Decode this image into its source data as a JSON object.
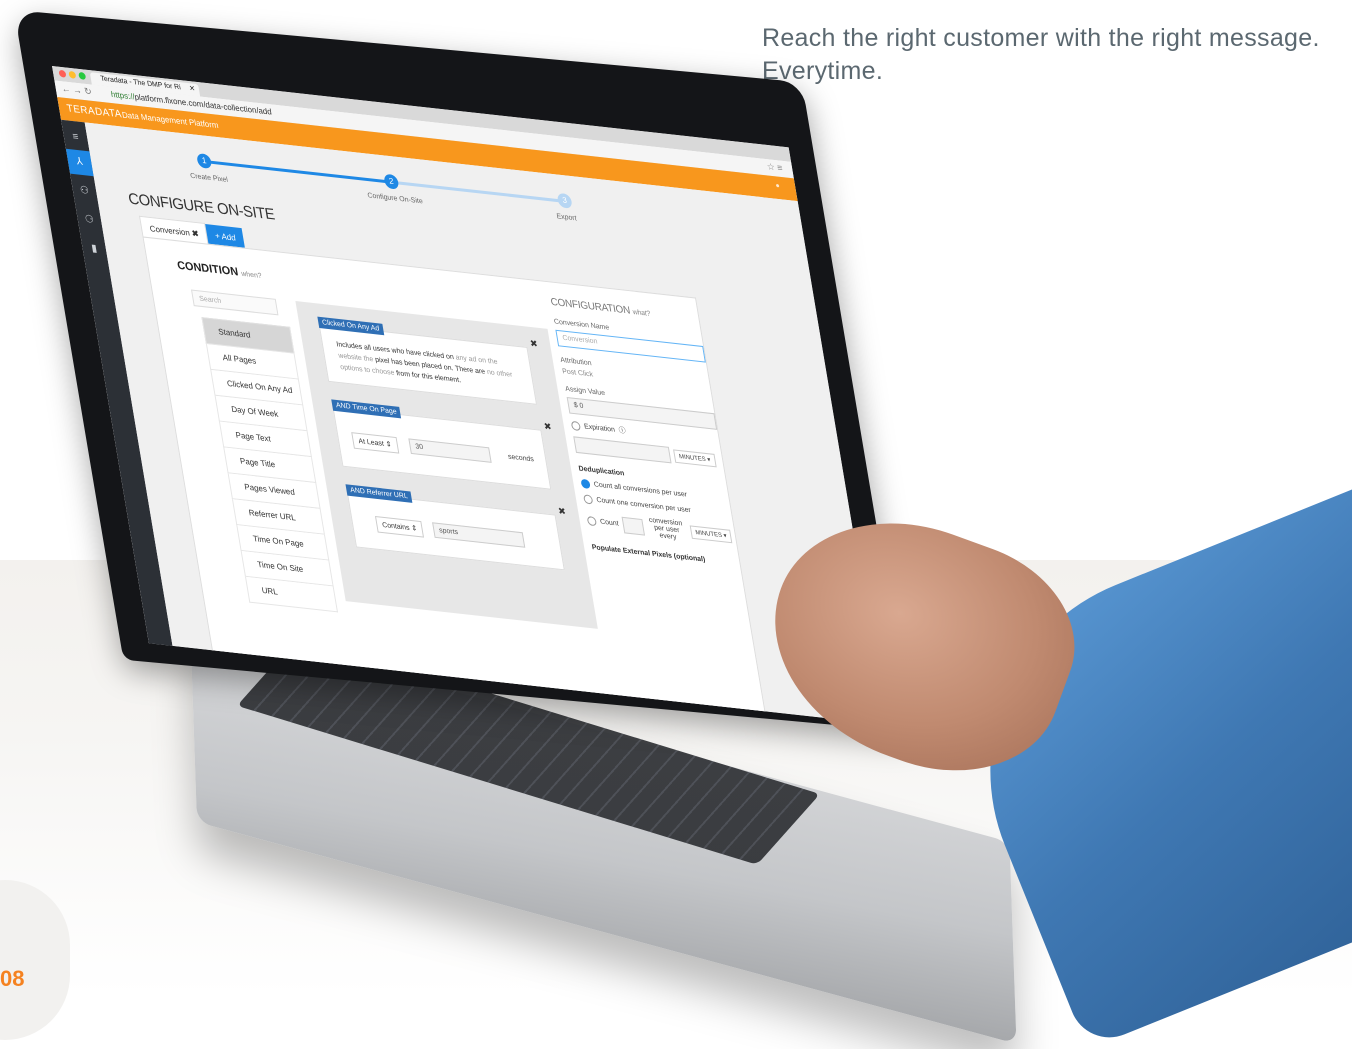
{
  "marketing": {
    "tagline": "Reach the right customer with the right message. Everytime.",
    "page_number": "08"
  },
  "browser": {
    "tab_title": "Teradata - The DMP for Ri",
    "url_protocol": "https://",
    "url_host": "platform.flxone.com",
    "url_path": "/data-collection/add"
  },
  "app": {
    "logo": "TERADATA",
    "subtitle": "Data Management Platform",
    "brand_color": "#f8971d",
    "accent_color": "#1e88e5",
    "sidebar_icons": [
      "menu-icon",
      "pixel-icon",
      "users-icon",
      "segments-icon",
      "analytics-icon"
    ]
  },
  "wizard": {
    "steps": [
      {
        "number": "1",
        "label": "Create Pixel"
      },
      {
        "number": "2",
        "label": "Configure On-Site"
      },
      {
        "number": "3",
        "label": "Export"
      }
    ],
    "active_step": 2,
    "title": "CONFIGURE ON-SITE",
    "tabs": {
      "conversion": "Conversion",
      "add": "+ Add"
    }
  },
  "condition": {
    "title": "CONDITION",
    "hint": "when?",
    "search_placeholder": "Search",
    "items": [
      "Standard",
      "All Pages",
      "Clicked On Any Ad",
      "Day Of Week",
      "Page Text",
      "Page Title",
      "Pages Viewed",
      "Referrer URL",
      "Time On Page",
      "Time On Site",
      "URL"
    ]
  },
  "rules": {
    "rule1": {
      "tag": "Clicked On Any Ad",
      "desc_lead": "Includes all users who have clicked on",
      "desc_muted": "any ad on the website the",
      "desc_rest": "pixel has been placed on. There are",
      "desc_muted2": "no other options to choose",
      "desc_end": "from for this element."
    },
    "rule2": {
      "tag": "AND Time On Page",
      "operator": "At Least",
      "value": "30",
      "unit": "seconds"
    },
    "rule3": {
      "tag": "AND Referrer URL",
      "operator": "Contains",
      "value": "sports"
    }
  },
  "configuration": {
    "title": "CONFIGURATION",
    "hint": "what?",
    "conversion_name_label": "Conversion Name",
    "conversion_name_placeholder": "Conversion",
    "attribution_label": "Attribution",
    "attribution_value": "Post Click",
    "assign_value_label": "Assign Value",
    "assign_value": "$ 0",
    "expiration_label": "Expiration",
    "minutes": "MINUTES",
    "deduplication_label": "Deduplication",
    "dedup_options": [
      "Count all conversions per user",
      "Count one conversion per user",
      "Count"
    ],
    "dedup_conversion_text": "conversion per user every",
    "populate_label": "Populate External Pixels (optional)"
  }
}
